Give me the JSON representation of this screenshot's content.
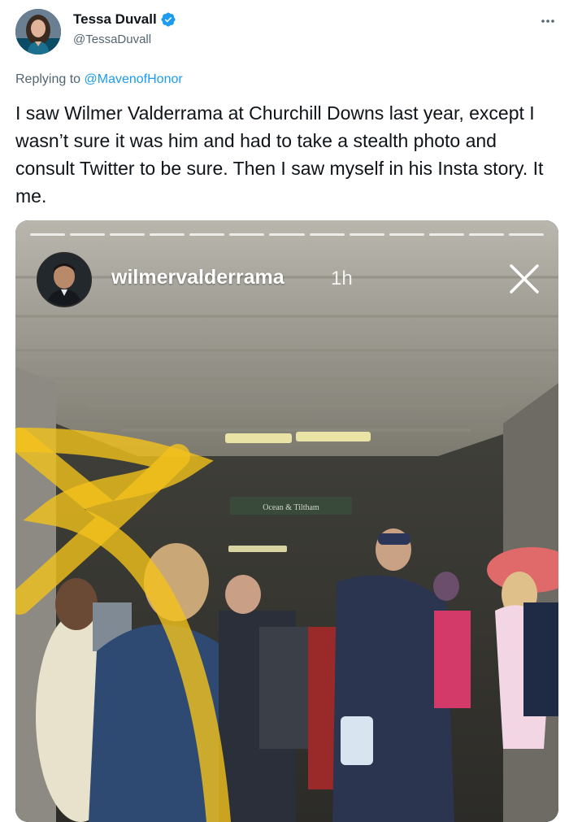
{
  "tweet": {
    "author_name": "Tessa Duvall",
    "author_handle": "@TessaDuvall",
    "replying_prefix": "Replying to ",
    "replying_to": "@MavenofHonor",
    "text": "I saw Wilmer Valderrama at Churchill Downs last year, except I wasn’t sure it was him and had to take a stealth photo and consult Twitter to be sure. Then I saw myself in his Insta story. It me."
  },
  "story": {
    "username": "wilmervalderrama",
    "time": "1h",
    "sign_text": "Ocean & Tiltham",
    "progress_segments": 13
  },
  "colors": {
    "link": "#1d9bf0",
    "verified": "#1d9bf0",
    "secondary_text": "#536471",
    "marker": "#f2c21b"
  },
  "icons": {
    "verified": "verified-badge-icon",
    "more": "more-horizontal-icon",
    "close": "close-icon"
  }
}
